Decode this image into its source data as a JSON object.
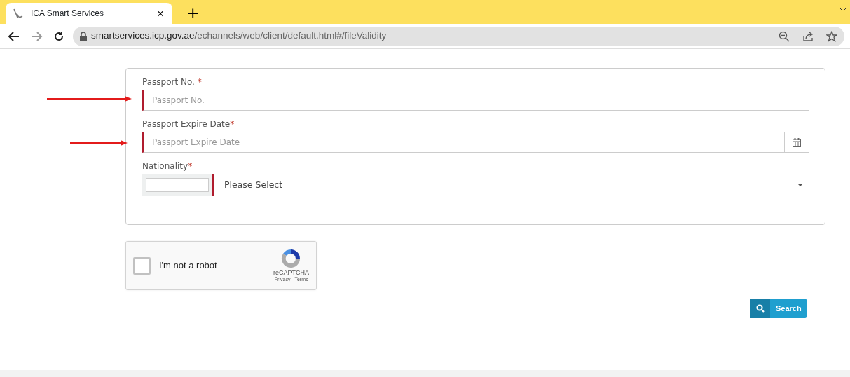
{
  "browser": {
    "tab": {
      "title": "ICA Smart Services",
      "close": "×"
    },
    "new_tab": "+",
    "url_host": "smartservices.icp.gov.ae",
    "url_path": "/echannels/web/client/default.html#/fileValidity"
  },
  "form": {
    "fields": [
      {
        "kind": "text",
        "label": "Passport No.",
        "required_mark": " *",
        "placeholder": "Passport No."
      },
      {
        "kind": "date",
        "label": "Passport Expire Date",
        "required_mark": "*",
        "placeholder": "Passport Expire Date"
      },
      {
        "kind": "select",
        "label": "Nationality",
        "required_mark": "*",
        "value": "Please Select"
      }
    ]
  },
  "captcha": {
    "label": "I'm not a robot",
    "checked": false,
    "brand": "reCAPTCHA",
    "links": "Privacy - Terms"
  },
  "search_button": "Search"
}
